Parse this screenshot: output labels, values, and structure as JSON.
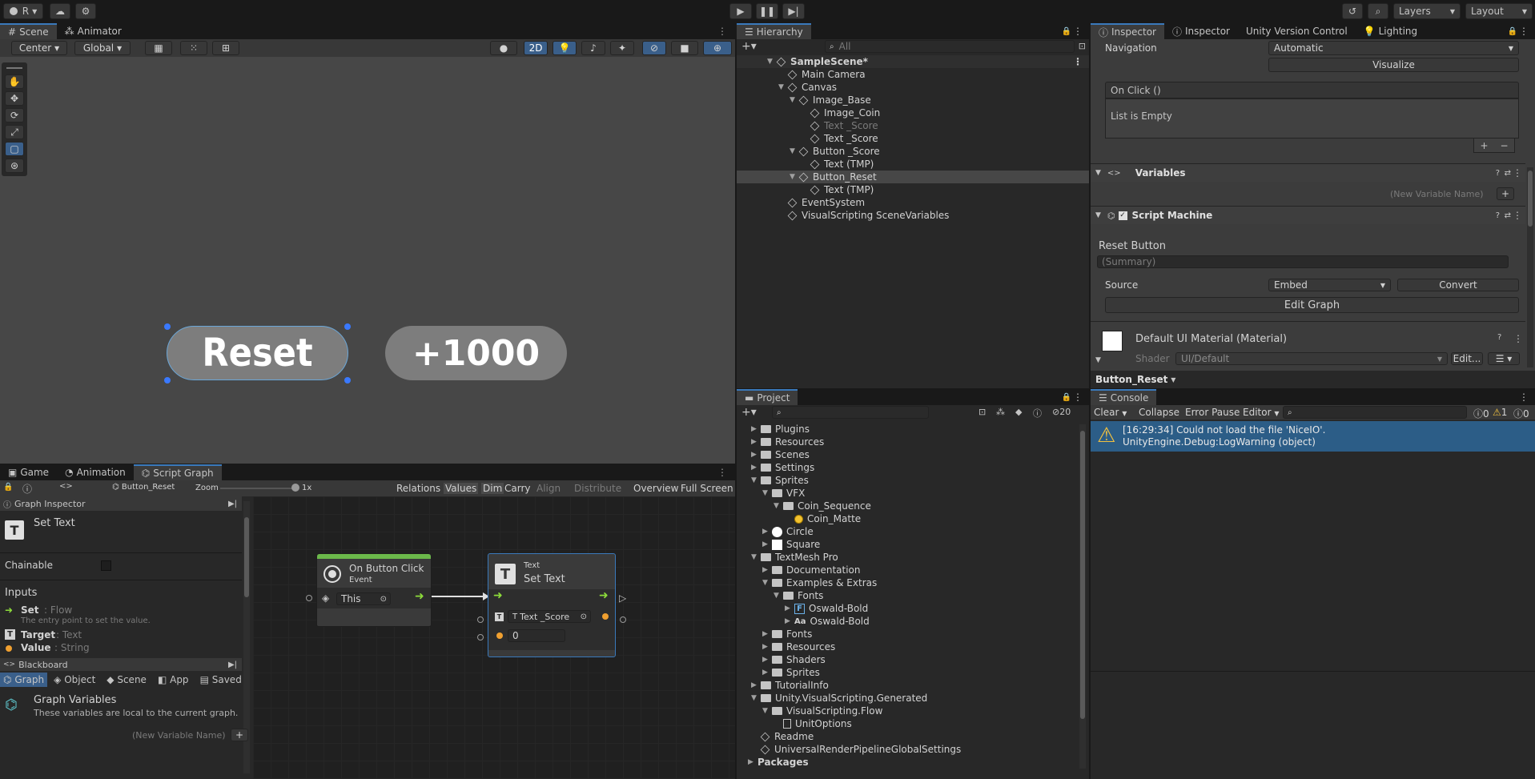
{
  "toolbar": {
    "account_initial": "R",
    "layers": "Layers",
    "layout": "Layout"
  },
  "scene": {
    "tabs": [
      "Scene",
      "Animator"
    ],
    "pivot": "Center",
    "space": "Global",
    "mode_2d": "2D",
    "button_reset": "Reset",
    "button_score": "+1000"
  },
  "hierarchy": {
    "tab": "Hierarchy",
    "search_placeholder": "All",
    "items": [
      {
        "label": "SampleScene*",
        "depth": 0,
        "type": "scene",
        "expanded": true
      },
      {
        "label": "Main Camera",
        "depth": 1,
        "type": "go"
      },
      {
        "label": "Canvas",
        "depth": 1,
        "type": "go",
        "expanded": true
      },
      {
        "label": "Image_Base",
        "depth": 2,
        "type": "go",
        "expanded": true
      },
      {
        "label": "Image_Coin",
        "depth": 3,
        "type": "go"
      },
      {
        "label": "Text _Score",
        "depth": 3,
        "type": "go",
        "dim": true
      },
      {
        "label": "Text _Score",
        "depth": 3,
        "type": "go"
      },
      {
        "label": "Button _Score",
        "depth": 2,
        "type": "go",
        "expanded": true
      },
      {
        "label": "Text (TMP)",
        "depth": 3,
        "type": "go"
      },
      {
        "label": "Button_Reset",
        "depth": 2,
        "type": "go",
        "expanded": true,
        "selected": true
      },
      {
        "label": "Text (TMP)",
        "depth": 3,
        "type": "go"
      },
      {
        "label": "EventSystem",
        "depth": 1,
        "type": "go"
      },
      {
        "label": "VisualScripting SceneVariables",
        "depth": 1,
        "type": "go"
      }
    ]
  },
  "inspector": {
    "tabs": [
      "Inspector",
      "Inspector",
      "Unity Version Control",
      "Lighting"
    ],
    "navigation_label": "Navigation",
    "navigation_value": "Automatic",
    "visualize": "Visualize",
    "onclick_header": "On Click ()",
    "onclick_empty": "List is Empty",
    "plus": "+",
    "minus": "−",
    "variables_title": "Variables",
    "new_variable_placeholder": "(New Variable Name)",
    "script_machine_title": "Script Machine",
    "machine_title": "Reset Button",
    "summary_placeholder": "(Summary)",
    "source_label": "Source",
    "source_value": "Embed",
    "convert": "Convert",
    "edit_graph": "Edit Graph",
    "material_title": "Default UI Material (Material)",
    "shader_label": "Shader",
    "shader_value": "UI/Default",
    "edit": "Edit...",
    "footer": "Button_Reset"
  },
  "graph": {
    "tabs": [
      "Game",
      "Animation",
      "Script Graph"
    ],
    "breadcrumb": "Button_Reset",
    "zoom_label": "Zoom",
    "zoom_value": "1x",
    "menu": [
      "Relations",
      "Values",
      "Dim",
      "Carry",
      "Align",
      "Distribute",
      "Overview",
      "Full Screen"
    ],
    "inspector_title": "Graph Inspector",
    "node_title": "Set Text",
    "chainable": "Chainable",
    "inputs_title": "Inputs",
    "inputs": [
      {
        "name": "Set",
        "type": ": Flow",
        "desc": "The entry point to set the value."
      },
      {
        "name": "Target",
        "type": ": Text",
        "desc": ""
      },
      {
        "name": "Value",
        "type": ": String",
        "desc": ""
      }
    ],
    "blackboard_title": "Blackboard",
    "blackboard_tabs": [
      "Graph",
      "Object",
      "Scene",
      "App",
      "Saved"
    ],
    "graph_vars_title": "Graph Variables",
    "graph_vars_desc": "These variables are local to the current graph.",
    "new_variable_placeholder": "(New Variable Name)",
    "node1_title": "On Button Click",
    "node1_sub": "Event",
    "node1_port": "This",
    "node2_sub": "Text",
    "node2_title": "Set Text",
    "node2_target": "Text _Score",
    "node2_value": "0"
  },
  "project": {
    "tab": "Project",
    "count": "20",
    "items": [
      {
        "label": "Plugins",
        "depth": 0,
        "expandable": true
      },
      {
        "label": "Resources",
        "depth": 0,
        "expandable": true
      },
      {
        "label": "Scenes",
        "depth": 0,
        "expandable": true
      },
      {
        "label": "Settings",
        "depth": 0,
        "expandable": true
      },
      {
        "label": "Sprites",
        "depth": 0,
        "expanded": true
      },
      {
        "label": "VFX",
        "depth": 1,
        "expanded": true
      },
      {
        "label": "Coin_Sequence",
        "depth": 2,
        "expanded": true
      },
      {
        "label": "Coin_Matte",
        "depth": 3,
        "icon": "coin"
      },
      {
        "label": "Circle",
        "depth": 1,
        "icon": "circle",
        "expandable": true
      },
      {
        "label": "Square",
        "depth": 1,
        "icon": "square",
        "expandable": true
      },
      {
        "label": "TextMesh Pro",
        "depth": 0,
        "expanded": true
      },
      {
        "label": "Documentation",
        "depth": 1,
        "expandable": true
      },
      {
        "label": "Examples & Extras",
        "depth": 1,
        "expanded": true
      },
      {
        "label": "Fonts",
        "depth": 2,
        "expanded": true
      },
      {
        "label": "Oswald-Bold",
        "depth": 3,
        "icon": "font-asset",
        "expandable": true
      },
      {
        "label": "Oswald-Bold",
        "depth": 3,
        "icon": "font",
        "expandable": true
      },
      {
        "label": "Fonts",
        "depth": 1,
        "expandable": true
      },
      {
        "label": "Resources",
        "depth": 1,
        "expandable": true
      },
      {
        "label": "Shaders",
        "depth": 1,
        "expandable": true
      },
      {
        "label": "Sprites",
        "depth": 1,
        "expandable": true
      },
      {
        "label": "TutorialInfo",
        "depth": 0,
        "expandable": true
      },
      {
        "label": "Unity.VisualScripting.Generated",
        "depth": 0,
        "expanded": true
      },
      {
        "label": "VisualScripting.Flow",
        "depth": 1,
        "expanded": true
      },
      {
        "label": "UnitOptions",
        "depth": 2,
        "icon": "file"
      },
      {
        "label": "Readme",
        "depth": 0,
        "icon": "asset"
      },
      {
        "label": "UniversalRenderPipelineGlobalSettings",
        "depth": 0,
        "icon": "asset"
      },
      {
        "label": "Packages",
        "depth": -1,
        "expandable": true
      }
    ]
  },
  "console": {
    "tab": "Console",
    "clear": "Clear",
    "collapse": "Collapse",
    "error_pause": "Error Pause",
    "editor": "Editor",
    "count_log": "0",
    "count_warn": "1",
    "count_err": "0",
    "message_line1": "[16:29:34] Could not load the file 'NiceIO'.",
    "message_line2": "UnityEngine.Debug:LogWarning (object)"
  }
}
